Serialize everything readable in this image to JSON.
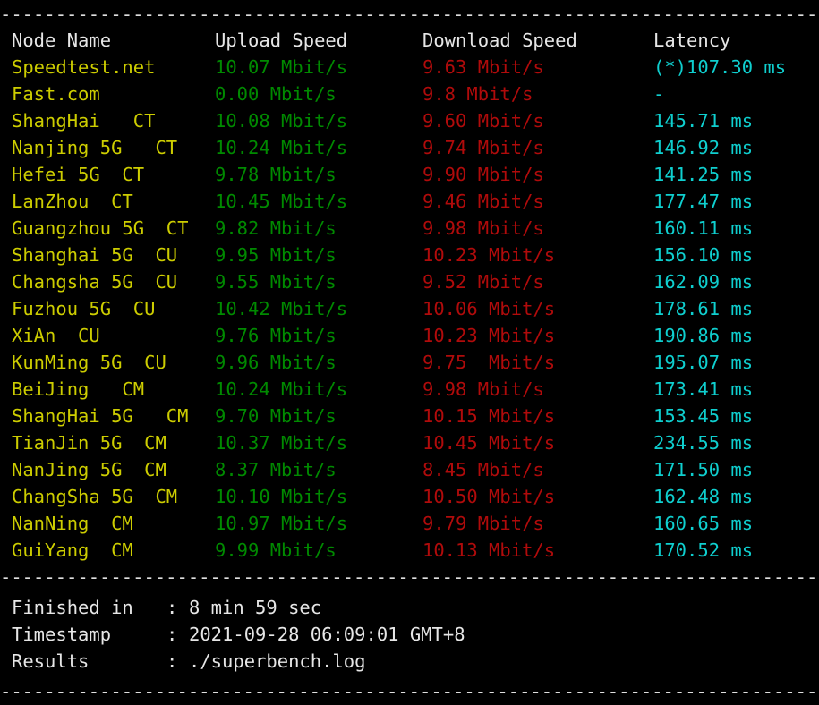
{
  "terminal": {
    "title": "superbench network speedtest results",
    "background": "#000000",
    "separator": "----------------------------------------------------------------------------",
    "colors": {
      "header": "#e6e6e6",
      "node": "#cdcd00",
      "upload": "#008a00",
      "download": "#b00b0b",
      "latency": "#0fcfcf",
      "footer": "#e6e6e6"
    }
  },
  "table": {
    "headers": {
      "node": "Node Name",
      "upload": "Upload Speed",
      "download": "Download Speed",
      "latency": "Latency"
    },
    "rows": [
      {
        "node": "Speedtest.net",
        "upload": "10.07 Mbit/s",
        "download": "9.63 Mbit/s",
        "latency": "(*)107.30 ms"
      },
      {
        "node": "Fast.com",
        "upload": "0.00 Mbit/s",
        "download": "9.8 Mbit/s",
        "latency": "-"
      },
      {
        "node": "ShangHai   CT",
        "upload": "10.08 Mbit/s",
        "download": "9.60 Mbit/s",
        "latency": "145.71 ms"
      },
      {
        "node": "Nanjing 5G   CT",
        "upload": "10.24 Mbit/s",
        "download": "9.74 Mbit/s",
        "latency": "146.92 ms"
      },
      {
        "node": "Hefei 5G  CT",
        "upload": "9.78 Mbit/s",
        "download": "9.90 Mbit/s",
        "latency": "141.25 ms"
      },
      {
        "node": "LanZhou  CT",
        "upload": "10.45 Mbit/s",
        "download": "9.46 Mbit/s",
        "latency": "177.47 ms"
      },
      {
        "node": "Guangzhou 5G  CT",
        "upload": "9.82 Mbit/s",
        "download": "9.98 Mbit/s",
        "latency": "160.11 ms"
      },
      {
        "node": "Shanghai 5G  CU",
        "upload": "9.95 Mbit/s",
        "download": "10.23 Mbit/s",
        "latency": "156.10 ms"
      },
      {
        "node": "Changsha 5G  CU",
        "upload": "9.55 Mbit/s",
        "download": "9.52 Mbit/s",
        "latency": "162.09 ms"
      },
      {
        "node": "Fuzhou 5G  CU",
        "upload": "10.42 Mbit/s",
        "download": "10.06 Mbit/s",
        "latency": "178.61 ms"
      },
      {
        "node": "XiAn  CU",
        "upload": "9.76 Mbit/s",
        "download": "10.23 Mbit/s",
        "latency": "190.86 ms"
      },
      {
        "node": "KunMing 5G  CU",
        "upload": "9.96 Mbit/s",
        "download": "9.75  Mbit/s",
        "latency": "195.07 ms"
      },
      {
        "node": "BeiJing   CM",
        "upload": "10.24 Mbit/s",
        "download": "9.98 Mbit/s",
        "latency": "173.41 ms"
      },
      {
        "node": "ShangHai 5G   CM",
        "upload": "9.70 Mbit/s",
        "download": "10.15 Mbit/s",
        "latency": "153.45 ms"
      },
      {
        "node": "TianJin 5G  CM",
        "upload": "10.37 Mbit/s",
        "download": "10.45 Mbit/s",
        "latency": "234.55 ms"
      },
      {
        "node": "NanJing 5G  CM",
        "upload": "8.37 Mbit/s",
        "download": "8.45 Mbit/s",
        "latency": "171.50 ms"
      },
      {
        "node": "ChangSha 5G  CM",
        "upload": "10.10 Mbit/s",
        "download": "10.50 Mbit/s",
        "latency": "162.48 ms"
      },
      {
        "node": "NanNing  CM",
        "upload": "10.97 Mbit/s",
        "download": "9.79 Mbit/s",
        "latency": "160.65 ms"
      },
      {
        "node": "GuiYang  CM",
        "upload": "9.99 Mbit/s",
        "download": "10.13 Mbit/s",
        "latency": "170.52 ms"
      }
    ]
  },
  "summary": [
    {
      "label": "Finished in",
      "colon": ":",
      "value": "8 min 59 sec"
    },
    {
      "label": "Timestamp",
      "colon": ":",
      "value": "2021-09-28 06:09:01 GMT+8"
    },
    {
      "label": "Results",
      "colon": ":",
      "value": "./superbench.log"
    }
  ]
}
